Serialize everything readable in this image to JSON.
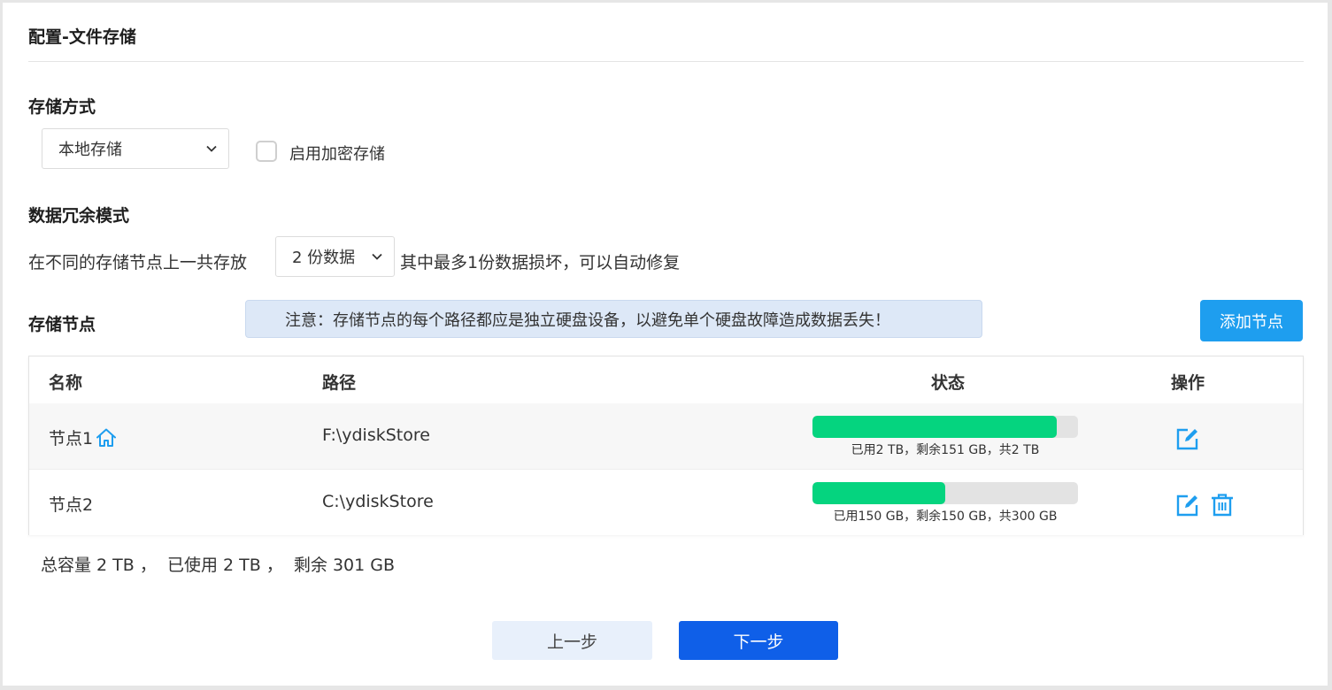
{
  "page": {
    "title": "配置-文件存储"
  },
  "storage_mode": {
    "label": "存储方式",
    "select_value": "本地存储",
    "encrypt_label": "启用加密存储",
    "encrypt_checked": false
  },
  "redundancy": {
    "label": "数据冗余模式",
    "prefix": "在不同的存储节点上一共存放",
    "select_value": "2 份数据",
    "suffix": "其中最多1份数据损坏，可以自动修复"
  },
  "nodes": {
    "label": "存储节点",
    "notice": "注意：存储节点的每个路径都应是独立硬盘设备，以避免单个硬盘故障造成数据丢失！",
    "add_button": "添加节点",
    "columns": [
      "名称",
      "路径",
      "状态",
      "操作"
    ],
    "rows": [
      {
        "name": "节点1",
        "home_icon": "home-icon",
        "path": "F:\\ydiskStore",
        "usage_fraction": 0.92,
        "status": "已用2 TB，剩余151 GB，共2 TB"
      },
      {
        "name": "节点2",
        "path": "C:\\ydiskStore",
        "usage_fraction": 0.5,
        "status": "已用150 GB，剩余150 GB，共300 GB"
      }
    ]
  },
  "summary": {
    "total": "总容量 2 TB ，",
    "used": "已使用 2 TB ，",
    "remaining": "剩余 301 GB"
  },
  "footer": {
    "prev": "上一步",
    "next": "下一步"
  },
  "colors": {
    "primary": "#0f5fe8",
    "accent": "#1e9eef",
    "progress": "#05d47f",
    "notice_bg": "#dde8f7"
  }
}
